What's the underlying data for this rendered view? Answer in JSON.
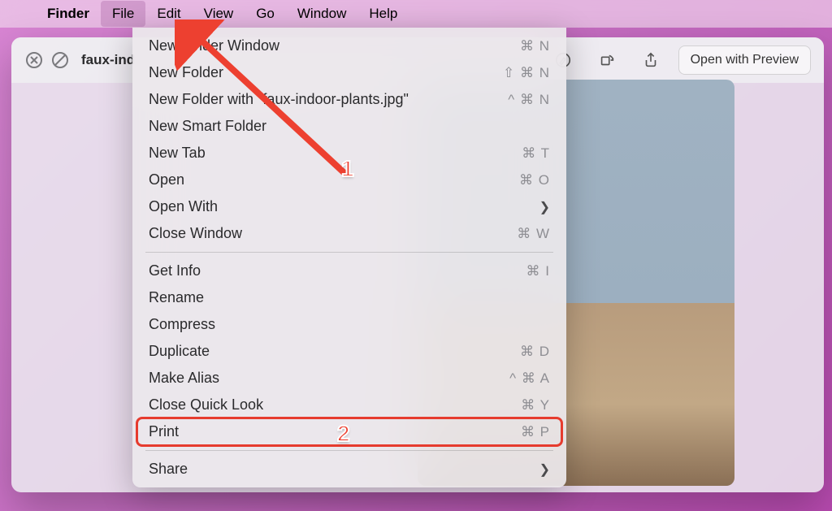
{
  "menubar": {
    "app": "Finder",
    "items": [
      "File",
      "Edit",
      "View",
      "Go",
      "Window",
      "Help"
    ],
    "active": "File"
  },
  "quicklook": {
    "title": "faux-ind",
    "open_button": "Open with Preview"
  },
  "dropdown": {
    "groups": [
      [
        {
          "label": "New Finder Window",
          "shortcut": "⌘ N"
        },
        {
          "label": "New Folder",
          "shortcut": "⇧ ⌘ N"
        },
        {
          "label": "New Folder with \"faux-indoor-plants.jpg\"",
          "shortcut": "^ ⌘ N"
        },
        {
          "label": "New Smart Folder",
          "shortcut": ""
        },
        {
          "label": "New Tab",
          "shortcut": "⌘ T"
        },
        {
          "label": "Open",
          "shortcut": "⌘ O"
        },
        {
          "label": "Open With",
          "shortcut": "",
          "submenu": true
        },
        {
          "label": "Close Window",
          "shortcut": "⌘ W"
        }
      ],
      [
        {
          "label": "Get Info",
          "shortcut": "⌘ I"
        },
        {
          "label": "Rename",
          "shortcut": ""
        },
        {
          "label": "Compress",
          "shortcut": ""
        },
        {
          "label": "Duplicate",
          "shortcut": "⌘ D"
        },
        {
          "label": "Make Alias",
          "shortcut": "^ ⌘ A"
        },
        {
          "label": "Close Quick Look",
          "shortcut": "⌘ Y"
        },
        {
          "label": "Print",
          "shortcut": "⌘ P",
          "highlight": true
        }
      ],
      [
        {
          "label": "Share",
          "shortcut": "",
          "submenu": true
        }
      ]
    ]
  },
  "annotations": {
    "num1": "1",
    "num2": "2"
  }
}
